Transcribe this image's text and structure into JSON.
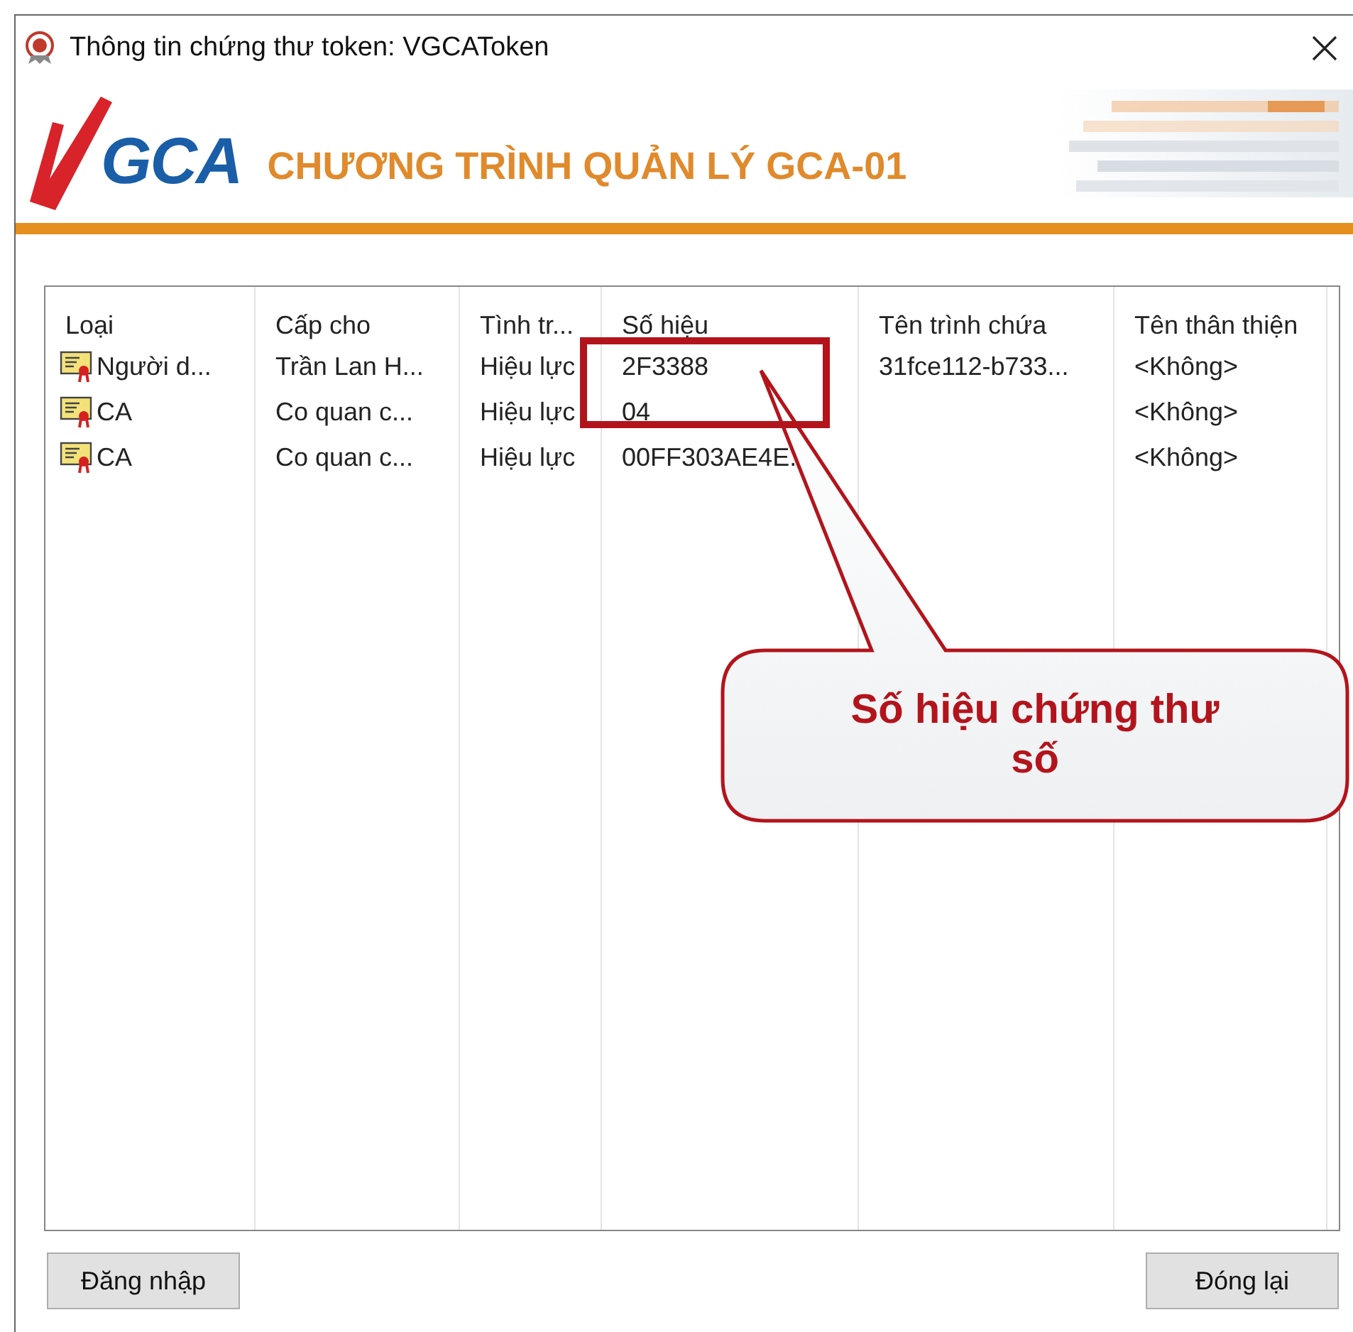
{
  "window": {
    "title": "Thông tin chứng thư token: VGCAToken"
  },
  "header": {
    "logo_text": "GCA",
    "title": "CHƯƠNG TRÌNH QUẢN LÝ GCA-01"
  },
  "table": {
    "columns": [
      "Loại",
      "Cấp cho",
      "Tình tr...",
      "Số hiệu",
      "Tên trình chứa",
      "Tên thân thiện"
    ],
    "rows": [
      {
        "cells": [
          "Người d...",
          "Trần Lan H...",
          "Hiệu lực",
          "2F3388",
          "31fce112-b733...",
          "<Không>"
        ]
      },
      {
        "cells": [
          "CA",
          "Co quan c...",
          "Hiệu lực",
          "04",
          "",
          "<Không>"
        ]
      },
      {
        "cells": [
          "CA",
          "Co quan c...",
          "Hiệu lực",
          "00FF303AE4E.",
          "",
          "<Không>"
        ]
      }
    ]
  },
  "callout": {
    "text": "Số hiệu chứng thư số"
  },
  "buttons": [
    "Đăng nhập",
    "Đóng lại"
  ]
}
